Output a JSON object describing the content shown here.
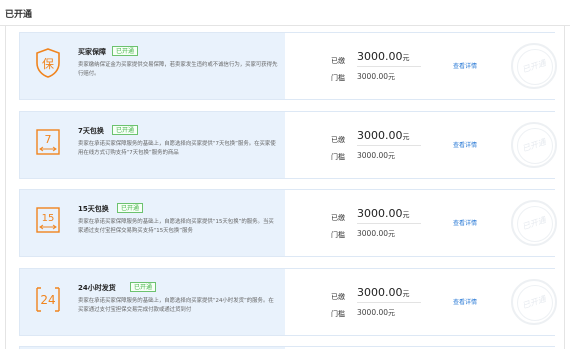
{
  "section": {
    "title": "已开通"
  },
  "services": [
    {
      "icon": "shield-bao-icon",
      "icon_glyph": "保",
      "name": "买家保障",
      "badge": "已开通",
      "description": "卖家缴纳保证金为买家提供交易保障，若卖家发生违约或不诚信行为，买家可获得先行赔付。",
      "fee_label": "已缴",
      "fee_value": "3000.00",
      "fee_unit": "元",
      "threshold_label": "门槛",
      "threshold_value": "3000.00",
      "threshold_unit": "元",
      "detail_link": "查看详情",
      "stamp": "已开通"
    },
    {
      "icon": "calendar-7-icon",
      "icon_glyph": "7",
      "name": "7天包换",
      "badge": "已开通",
      "description": "卖家在承诺买家保障服务的基础上，自愿选择向买家提供“7天包换”服务。在买家使用在线方式订购支持“7天包换”服务的商品",
      "fee_label": "已缴",
      "fee_value": "3000.00",
      "fee_unit": "元",
      "threshold_label": "门槛",
      "threshold_value": "3000.00",
      "threshold_unit": "元",
      "detail_link": "查看详情",
      "stamp": "已开通"
    },
    {
      "icon": "calendar-15-icon",
      "icon_glyph": "15",
      "name": "15天包换",
      "badge": "已开通",
      "description": "卖家在承诺买家保障服务的基础上，自愿选择向买家提供“15天包换”的服务。当买家通过支付宝担保交易购买支持“15天包换”服务",
      "fee_label": "已缴",
      "fee_value": "3000.00",
      "fee_unit": "元",
      "threshold_label": "门槛",
      "threshold_value": "3000.00",
      "threshold_unit": "元",
      "detail_link": "查看详情",
      "stamp": "已开通"
    },
    {
      "icon": "clock-24-icon",
      "icon_glyph": "24",
      "name": "24小时发货",
      "badge": "已开通",
      "description": "卖家在承诺买家保障服务的基础上，自愿选择向买家提供“24小时发货”的服务。在买家通过支付宝担保交易完成付款或通过货到付",
      "fee_label": "已缴",
      "fee_value": "3000.00",
      "fee_unit": "元",
      "threshold_label": "门槛",
      "threshold_value": "3000.00",
      "threshold_unit": "元",
      "detail_link": "查看详情",
      "stamp": "已开通"
    }
  ],
  "colors": {
    "accent_orange": "#f0841e",
    "badge_green": "#46b54a",
    "link_blue": "#2a7ad6",
    "card_bg": "#e9f2fc"
  }
}
